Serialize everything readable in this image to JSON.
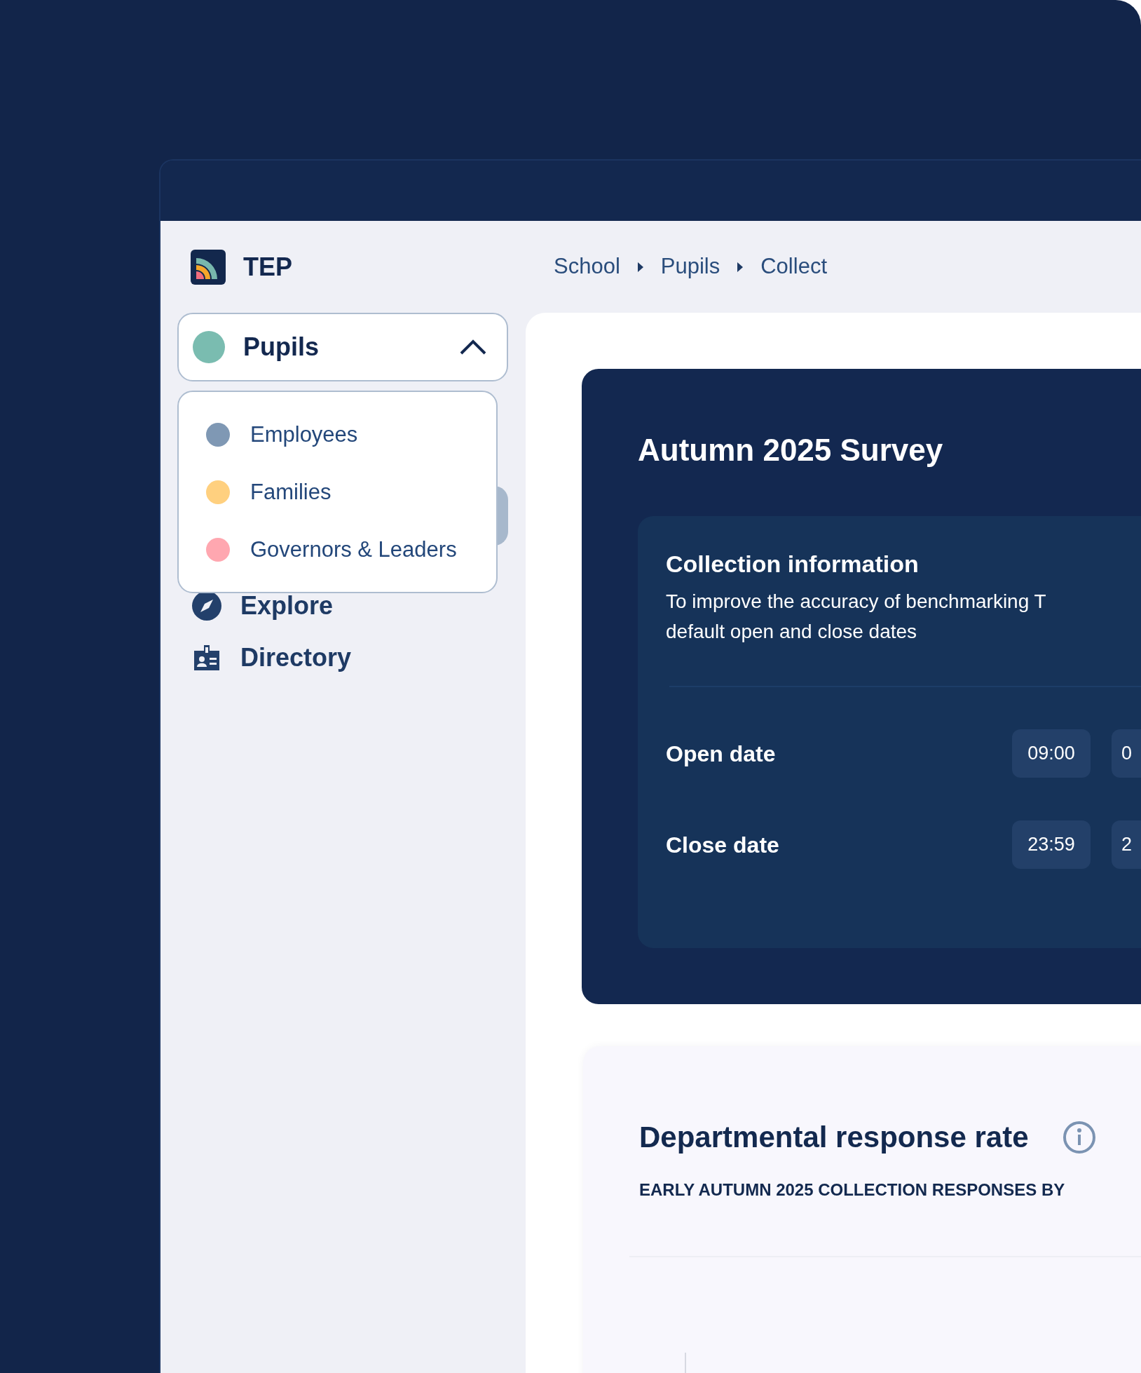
{
  "app": {
    "name": "TEP"
  },
  "breadcrumbs": [
    "School",
    "Pupils",
    "Collect"
  ],
  "group_selector": {
    "label": "Pupils",
    "color": "#7abcb0",
    "expanded": true,
    "options": [
      {
        "label": "Employees",
        "color": "#7f98b4"
      },
      {
        "label": "Families",
        "color": "#ffd07f"
      },
      {
        "label": "Governors & Leaders",
        "color": "#ffa7b0"
      }
    ]
  },
  "nav": [
    {
      "kind": "explore",
      "label": "Explore"
    },
    {
      "kind": "directory",
      "label": "Directory"
    }
  ],
  "survey": {
    "title": "Autumn 2025 Survey",
    "collection": {
      "heading": "Collection information",
      "description_lines": [
        "To improve the accuracy of benchmarking T",
        "default open and close dates"
      ],
      "dates": [
        {
          "label": "Open date",
          "time": "09:00",
          "date": "0"
        },
        {
          "label": "Close date",
          "time": "23:59",
          "date": "2"
        }
      ]
    }
  },
  "response_rate": {
    "title": "Departmental response rate",
    "subtitle": "EARLY AUTUMN 2025 COLLECTION RESPONSES BY"
  }
}
